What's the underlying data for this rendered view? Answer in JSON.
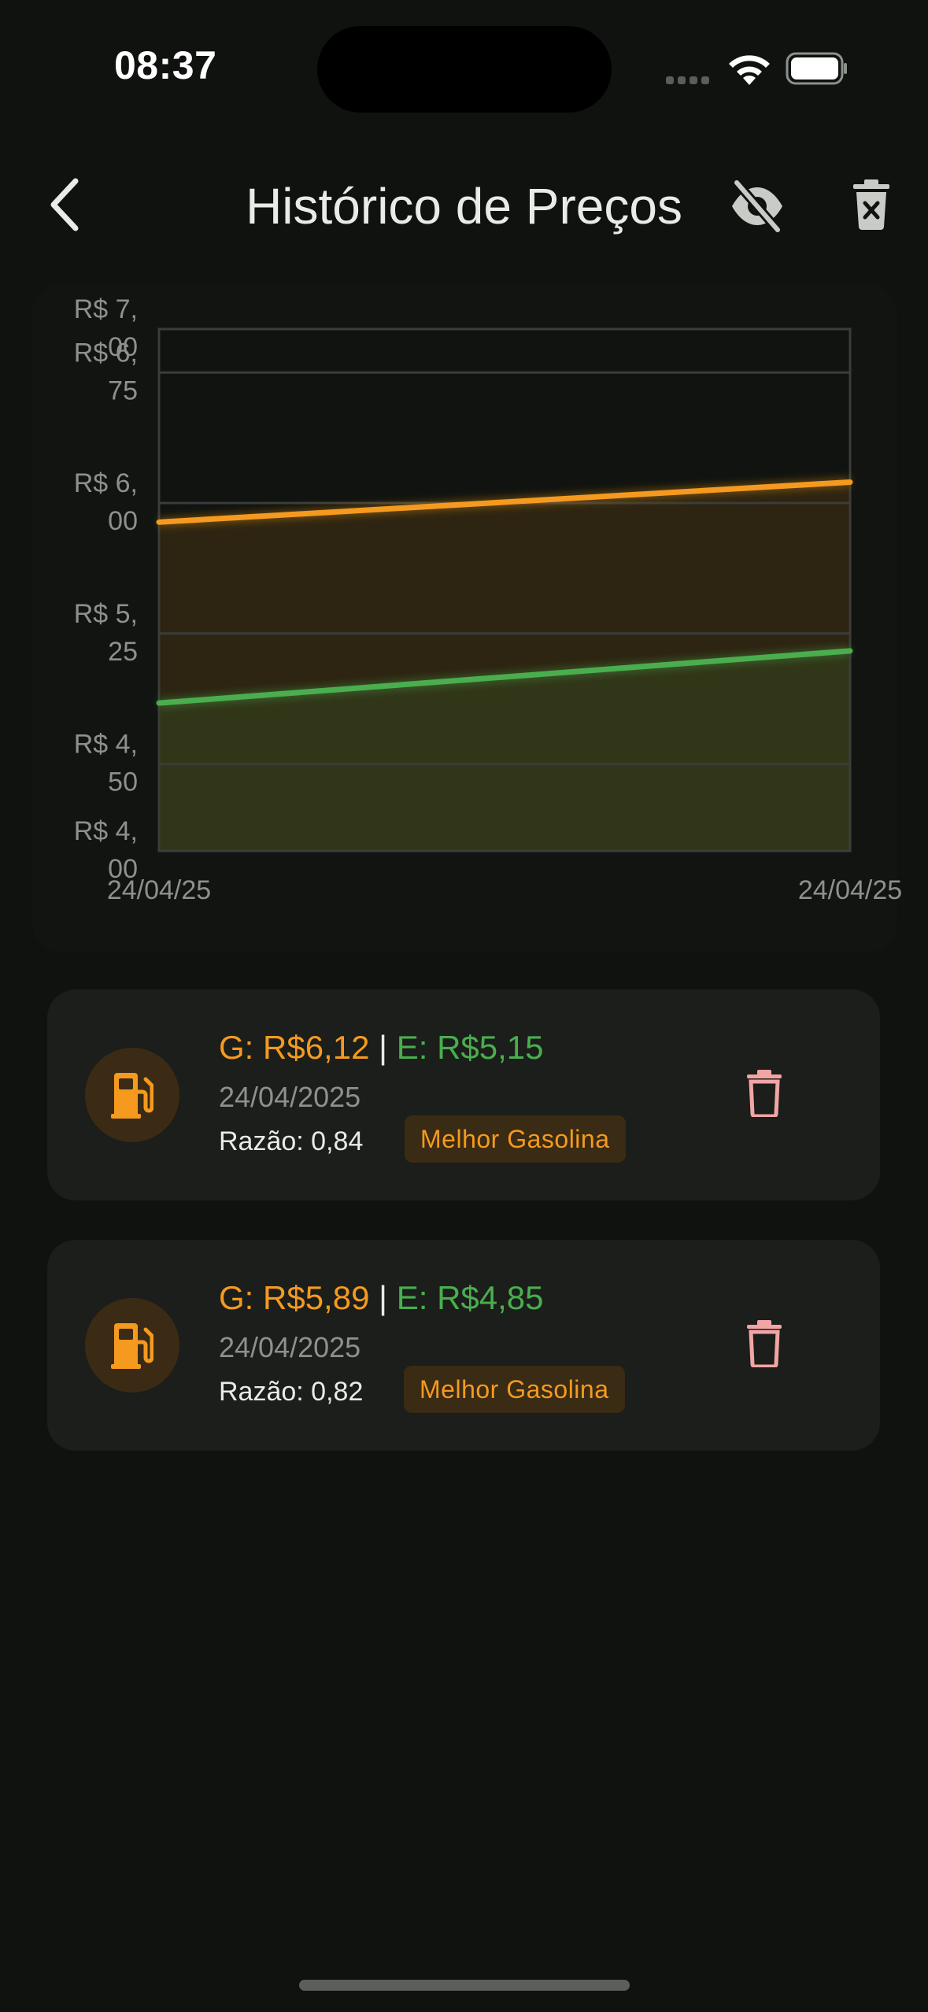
{
  "status_bar": {
    "time": "08:37"
  },
  "header": {
    "title": "Histórico de Preços",
    "back_icon": "chevron-left-icon",
    "hide_icon": "eye-off-icon",
    "clear_icon": "trash-x-icon"
  },
  "colors": {
    "gasoline": "#f59a1f",
    "ethanol": "#4aae4f",
    "delete": "#f2a5a5",
    "background": "#0f120f"
  },
  "chart_data": {
    "type": "line",
    "x": [
      "24/04/25",
      "24/04/25"
    ],
    "x_tick_labels": [
      "24/04/25",
      "24/04/25"
    ],
    "y_tick_labels": [
      {
        "value": 7.0,
        "lines": [
          "R$ 7,",
          "00"
        ]
      },
      {
        "value": 6.75,
        "lines": [
          "R$ 6,",
          "75"
        ]
      },
      {
        "value": 6.0,
        "lines": [
          "R$ 6,",
          "00"
        ]
      },
      {
        "value": 5.25,
        "lines": [
          "R$ 5,",
          "25"
        ]
      },
      {
        "value": 4.5,
        "lines": [
          "R$ 4,",
          "50"
        ]
      },
      {
        "value": 4.0,
        "lines": [
          "R$ 4,",
          "00"
        ]
      }
    ],
    "gridlines": [
      6.75,
      6.0,
      5.25,
      4.5
    ],
    "ylim": [
      4.0,
      7.0
    ],
    "series": [
      {
        "values": [
          5.89,
          6.12
        ],
        "color": "#f59a1f",
        "fill": true
      },
      {
        "values": [
          4.85,
          5.15
        ],
        "color": "#4aae4f",
        "fill": true
      }
    ],
    "grid": true
  },
  "records": [
    {
      "gas_price": "G: R$6,12",
      "separator": "|",
      "eth_price": "E: R$5,15",
      "date": "24/04/2025",
      "ratio": "Razão: 0,84",
      "badge": "Melhor Gasolina",
      "icon": "fuel-pump-icon",
      "delete_icon": "trash-icon"
    },
    {
      "gas_price": "G: R$5,89",
      "separator": "|",
      "eth_price": "E: R$4,85",
      "date": "24/04/2025",
      "ratio": "Razão: 0,82",
      "badge": "Melhor Gasolina",
      "icon": "fuel-pump-icon",
      "delete_icon": "trash-icon"
    }
  ]
}
